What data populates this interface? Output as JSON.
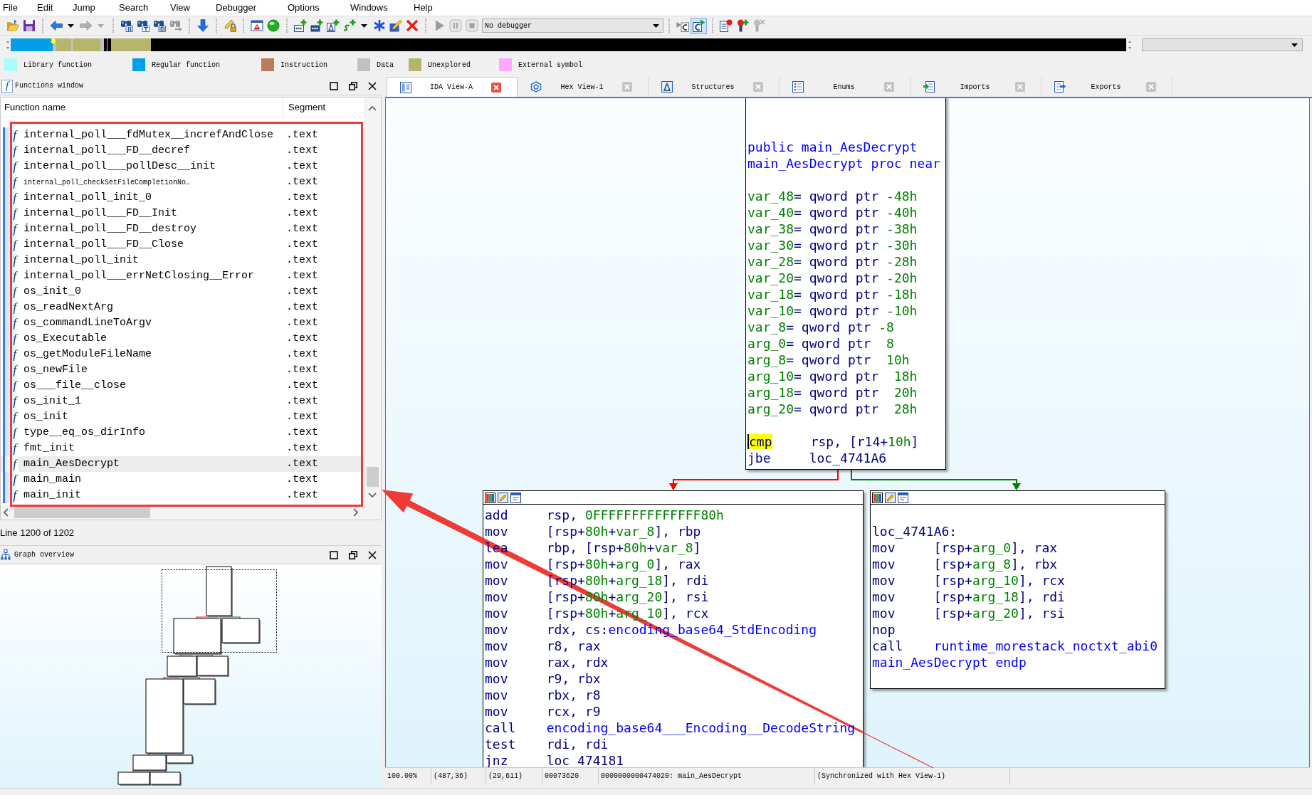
{
  "menu": [
    "File",
    "Edit",
    "Jump",
    "Search",
    "View",
    "Debugger",
    "Options",
    "Windows",
    "Help"
  ],
  "toolbar": [
    {
      "items": [
        {
          "kind": "button",
          "disabled": false,
          "pressed": false
        },
        {
          "kind": "button",
          "disabled": false,
          "pressed": false
        }
      ]
    },
    {
      "items": [
        {
          "kind": "button",
          "disabled": false,
          "pressed": false
        },
        {
          "kind": "caret",
          "disabled": false
        },
        {
          "kind": "button",
          "disabled": true,
          "pressed": false
        },
        {
          "kind": "caret",
          "disabled": true
        }
      ]
    },
    {
      "items": [
        {
          "kind": "button",
          "disabled": false,
          "pressed": false
        },
        {
          "kind": "button",
          "disabled": false,
          "pressed": false
        },
        {
          "kind": "button",
          "disabled": false,
          "pressed": false
        },
        {
          "kind": "button",
          "disabled": true,
          "pressed": false
        }
      ]
    },
    {
      "items": [
        {
          "kind": "button",
          "disabled": false,
          "pressed": false
        }
      ]
    },
    {
      "items": [
        {
          "kind": "button",
          "disabled": false,
          "pressed": false
        }
      ]
    },
    {
      "items": [
        {
          "kind": "button",
          "disabled": false,
          "pressed": false
        },
        {
          "kind": "button",
          "disabled": false,
          "pressed": false
        }
      ]
    },
    {
      "items": [
        {
          "kind": "button",
          "disabled": false,
          "pressed": false
        },
        {
          "kind": "button",
          "disabled": false,
          "pressed": false
        },
        {
          "kind": "button",
          "disabled": false,
          "pressed": false
        },
        {
          "kind": "button",
          "disabled": false,
          "pressed": false
        },
        {
          "kind": "caret",
          "disabled": false
        },
        {
          "kind": "button",
          "disabled": false,
          "pressed": false
        },
        {
          "kind": "button",
          "disabled": false,
          "pressed": false
        },
        {
          "kind": "button",
          "disabled": false,
          "pressed": false
        }
      ]
    },
    {
      "items": [
        {
          "kind": "button",
          "disabled": true,
          "pressed": false
        },
        {
          "kind": "button",
          "disabled": true,
          "pressed": false
        },
        {
          "kind": "button",
          "disabled": true,
          "pressed": false
        },
        {
          "kind": "select",
          "value": "No debugger"
        }
      ]
    },
    {
      "items": [
        {
          "kind": "button",
          "disabled": false,
          "pressed": false
        },
        {
          "kind": "button",
          "disabled": false,
          "pressed": true
        }
      ]
    },
    {
      "items": [
        {
          "kind": "button",
          "disabled": false,
          "pressed": false
        },
        {
          "kind": "button",
          "disabled": false,
          "pressed": false
        },
        {
          "kind": "button",
          "disabled": true,
          "pressed": false
        }
      ]
    }
  ],
  "legend": [
    {
      "label": "Library function",
      "color": "#a8fcfc"
    },
    {
      "label": "Regular function",
      "color": "#00a0e6"
    },
    {
      "label": "Instruction",
      "color": "#b87c5c"
    },
    {
      "label": "Data",
      "color": "#c0c0c0"
    },
    {
      "label": "Unexplored",
      "color": "#b4b46c"
    },
    {
      "label": "External symbol",
      "color": "#ffa8ff"
    }
  ],
  "functions_window": {
    "icon": "f",
    "title": "Functions window",
    "columns": [
      "Function name",
      "Segment"
    ],
    "rows": [
      {
        "icon": "f",
        "name": "internal_poll___fdMutex__increfAndClose",
        "segment": ".text",
        "selected": false,
        "squeezed": false
      },
      {
        "icon": "f",
        "name": "internal_poll___FD__decref",
        "segment": ".text",
        "selected": false,
        "squeezed": false
      },
      {
        "icon": "f",
        "name": "internal_poll___pollDesc__init",
        "segment": ".text",
        "selected": false,
        "squeezed": false
      },
      {
        "icon": "f",
        "name": "internal_poll_checkSetFileCompletionNo…",
        "segment": ".text",
        "selected": false,
        "squeezed": true
      },
      {
        "icon": "f",
        "name": "internal_poll_init_0",
        "segment": ".text",
        "selected": false,
        "squeezed": false
      },
      {
        "icon": "f",
        "name": "internal_poll___FD__Init",
        "segment": ".text",
        "selected": false,
        "squeezed": false
      },
      {
        "icon": "f",
        "name": "internal_poll___FD__destroy",
        "segment": ".text",
        "selected": false,
        "squeezed": false
      },
      {
        "icon": "f",
        "name": "internal_poll___FD__Close",
        "segment": ".text",
        "selected": false,
        "squeezed": false
      },
      {
        "icon": "f",
        "name": "internal_poll_init",
        "segment": ".text",
        "selected": false,
        "squeezed": false
      },
      {
        "icon": "f",
        "name": "internal_poll___errNetClosing__Error",
        "segment": ".text",
        "selected": false,
        "squeezed": false
      },
      {
        "icon": "f",
        "name": "os_init_0",
        "segment": ".text",
        "selected": false,
        "squeezed": false
      },
      {
        "icon": "f",
        "name": "os_readNextArg",
        "segment": ".text",
        "selected": false,
        "squeezed": false
      },
      {
        "icon": "f",
        "name": "os_commandLineToArgv",
        "segment": ".text",
        "selected": false,
        "squeezed": false
      },
      {
        "icon": "f",
        "name": "os_Executable",
        "segment": ".text",
        "selected": false,
        "squeezed": false
      },
      {
        "icon": "f",
        "name": "os_getModuleFileName",
        "segment": ".text",
        "selected": false,
        "squeezed": false
      },
      {
        "icon": "f",
        "name": "os_newFile",
        "segment": ".text",
        "selected": false,
        "squeezed": false
      },
      {
        "icon": "f",
        "name": "os___file__close",
        "segment": ".text",
        "selected": false,
        "squeezed": false
      },
      {
        "icon": "f",
        "name": "os_init_1",
        "segment": ".text",
        "selected": false,
        "squeezed": false
      },
      {
        "icon": "f",
        "name": "os_init",
        "segment": ".text",
        "selected": false,
        "squeezed": false
      },
      {
        "icon": "f",
        "name": "type__eq_os_dirInfo",
        "segment": ".text",
        "selected": false,
        "squeezed": false
      },
      {
        "icon": "f",
        "name": "fmt_init",
        "segment": ".text",
        "selected": false,
        "squeezed": false
      },
      {
        "icon": "f",
        "name": "main_AesDecrypt",
        "segment": ".text",
        "selected": true,
        "squeezed": false
      },
      {
        "icon": "f",
        "name": "main_main",
        "segment": ".text",
        "selected": false,
        "squeezed": false
      },
      {
        "icon": "f",
        "name": "main_init",
        "segment": ".text",
        "selected": false,
        "squeezed": false
      }
    ],
    "status": "Line 1200 of 1202"
  },
  "graph_overview": {
    "title": "Graph overview"
  },
  "tabs": [
    {
      "label": "IDA View-A",
      "selected": true
    },
    {
      "label": "Hex View-1",
      "selected": false
    },
    {
      "label": "Structures",
      "selected": false
    },
    {
      "label": "Enums",
      "selected": false
    },
    {
      "label": "Imports",
      "selected": false
    },
    {
      "label": "Exports",
      "selected": false
    }
  ],
  "graph": {
    "nodes": [
      {
        "blocks": [
          {
            "lines": [
              [
                {
                  "text": "public main_AesDecrypt",
                  "kind": "name"
                }
              ],
              [
                {
                  "text": "main_AesDecrypt proc near",
                  "kind": "name"
                }
              ]
            ]
          },
          {
            "lines": [
              [
                {
                  "text": "var_48",
                  "kind": "number"
                },
                {
                  "text": "= qword ptr ",
                  "kind": "plain"
                },
                {
                  "text": "-48h",
                  "kind": "number"
                }
              ],
              [
                {
                  "text": "var_40",
                  "kind": "number"
                },
                {
                  "text": "= qword ptr ",
                  "kind": "plain"
                },
                {
                  "text": "-40h",
                  "kind": "number"
                }
              ],
              [
                {
                  "text": "var_38",
                  "kind": "number"
                },
                {
                  "text": "= qword ptr ",
                  "kind": "plain"
                },
                {
                  "text": "-38h",
                  "kind": "number"
                }
              ],
              [
                {
                  "text": "var_30",
                  "kind": "number"
                },
                {
                  "text": "= qword ptr ",
                  "kind": "plain"
                },
                {
                  "text": "-30h",
                  "kind": "number"
                }
              ],
              [
                {
                  "text": "var_28",
                  "kind": "number"
                },
                {
                  "text": "= qword ptr ",
                  "kind": "plain"
                },
                {
                  "text": "-28h",
                  "kind": "number"
                }
              ],
              [
                {
                  "text": "var_20",
                  "kind": "number"
                },
                {
                  "text": "= qword ptr ",
                  "kind": "plain"
                },
                {
                  "text": "-20h",
                  "kind": "number"
                }
              ],
              [
                {
                  "text": "var_18",
                  "kind": "number"
                },
                {
                  "text": "= qword ptr ",
                  "kind": "plain"
                },
                {
                  "text": "-18h",
                  "kind": "number"
                }
              ],
              [
                {
                  "text": "var_10",
                  "kind": "number"
                },
                {
                  "text": "= qword ptr ",
                  "kind": "plain"
                },
                {
                  "text": "-10h",
                  "kind": "number"
                }
              ],
              [
                {
                  "text": "var_8",
                  "kind": "number"
                },
                {
                  "text": "= qword ptr ",
                  "kind": "plain"
                },
                {
                  "text": "-8",
                  "kind": "number"
                }
              ],
              [
                {
                  "text": "arg_0",
                  "kind": "number"
                },
                {
                  "text": "= qword ptr  ",
                  "kind": "plain"
                },
                {
                  "text": "8",
                  "kind": "number"
                }
              ],
              [
                {
                  "text": "arg_8",
                  "kind": "number"
                },
                {
                  "text": "= qword ptr  ",
                  "kind": "plain"
                },
                {
                  "text": "10h",
                  "kind": "number"
                }
              ],
              [
                {
                  "text": "arg_10",
                  "kind": "number"
                },
                {
                  "text": "= qword ptr  ",
                  "kind": "plain"
                },
                {
                  "text": "18h",
                  "kind": "number"
                }
              ],
              [
                {
                  "text": "arg_18",
                  "kind": "number"
                },
                {
                  "text": "= qword ptr  ",
                  "kind": "plain"
                },
                {
                  "text": "20h",
                  "kind": "number"
                }
              ],
              [
                {
                  "text": "arg_20",
                  "kind": "number"
                },
                {
                  "text": "= qword ptr  ",
                  "kind": "plain"
                },
                {
                  "text": "28h",
                  "kind": "number"
                }
              ]
            ]
          },
          {
            "lines": [
              [
                {
                  "text": "cmp",
                  "kind": "cursor"
                },
                {
                  "text": "     rsp, [r14+",
                  "kind": "plain"
                },
                {
                  "text": "10h",
                  "kind": "number"
                },
                {
                  "text": "]",
                  "kind": "plain"
                }
              ],
              [
                {
                  "text": "jbe     loc_4741A6",
                  "kind": "plain"
                }
              ]
            ]
          }
        ]
      },
      {
        "blocks": [
          {
            "lines": [
              [
                {
                  "text": "add     rsp, ",
                  "kind": "plain"
                },
                {
                  "text": "0FFFFFFFFFFFFFF80h",
                  "kind": "number"
                }
              ],
              [
                {
                  "text": "mov     [rsp+",
                  "kind": "plain"
                },
                {
                  "text": "80h",
                  "kind": "number"
                },
                {
                  "text": "+",
                  "kind": "plain"
                },
                {
                  "text": "var_8",
                  "kind": "number"
                },
                {
                  "text": "], rbp",
                  "kind": "plain"
                }
              ],
              [
                {
                  "text": "lea     rbp, [rsp+",
                  "kind": "plain"
                },
                {
                  "text": "80h",
                  "kind": "number"
                },
                {
                  "text": "+",
                  "kind": "plain"
                },
                {
                  "text": "var_8",
                  "kind": "number"
                },
                {
                  "text": "]",
                  "kind": "plain"
                }
              ],
              [
                {
                  "text": "mov     [rsp+",
                  "kind": "plain"
                },
                {
                  "text": "80h",
                  "kind": "number"
                },
                {
                  "text": "+",
                  "kind": "plain"
                },
                {
                  "text": "arg_0",
                  "kind": "number"
                },
                {
                  "text": "], rax",
                  "kind": "plain"
                }
              ],
              [
                {
                  "text": "mov     [rsp+",
                  "kind": "plain"
                },
                {
                  "text": "80h",
                  "kind": "number"
                },
                {
                  "text": "+",
                  "kind": "plain"
                },
                {
                  "text": "arg_18",
                  "kind": "number"
                },
                {
                  "text": "], rdi",
                  "kind": "plain"
                }
              ],
              [
                {
                  "text": "mov     [rsp+",
                  "kind": "plain"
                },
                {
                  "text": "80h",
                  "kind": "number"
                },
                {
                  "text": "+",
                  "kind": "plain"
                },
                {
                  "text": "arg_20",
                  "kind": "number"
                },
                {
                  "text": "], rsi",
                  "kind": "plain"
                }
              ],
              [
                {
                  "text": "mov     [rsp+",
                  "kind": "plain"
                },
                {
                  "text": "80h",
                  "kind": "number"
                },
                {
                  "text": "+",
                  "kind": "plain"
                },
                {
                  "text": "arg_10",
                  "kind": "number"
                },
                {
                  "text": "], rcx",
                  "kind": "plain"
                }
              ],
              [
                {
                  "text": "mov     rdx, cs:",
                  "kind": "plain"
                },
                {
                  "text": "encoding_base64_StdEncoding",
                  "kind": "name"
                }
              ],
              [
                {
                  "text": "mov     r8, rax",
                  "kind": "plain"
                }
              ],
              [
                {
                  "text": "mov     rax, rdx",
                  "kind": "plain"
                }
              ],
              [
                {
                  "text": "mov     r9, rbx",
                  "kind": "plain"
                }
              ],
              [
                {
                  "text": "mov     rbx, r8",
                  "kind": "plain"
                }
              ],
              [
                {
                  "text": "mov     rcx, r9",
                  "kind": "plain"
                }
              ],
              [
                {
                  "text": "call    ",
                  "kind": "plain"
                },
                {
                  "text": "encoding_base64___Encoding__DecodeString",
                  "kind": "name"
                }
              ],
              [
                {
                  "text": "test    rdi, rdi",
                  "kind": "plain"
                }
              ],
              [
                {
                  "text": "jnz     loc_474181",
                  "kind": "plain"
                }
              ]
            ]
          }
        ]
      },
      {
        "blocks": [
          {
            "lines": [
              [
                {
                  "text": "loc_4741A6:",
                  "kind": "plain"
                }
              ],
              [
                {
                  "text": "mov     [rsp+",
                  "kind": "plain"
                },
                {
                  "text": "arg_0",
                  "kind": "number"
                },
                {
                  "text": "], rax",
                  "kind": "plain"
                }
              ],
              [
                {
                  "text": "mov     [rsp+",
                  "kind": "plain"
                },
                {
                  "text": "arg_8",
                  "kind": "number"
                },
                {
                  "text": "], rbx",
                  "kind": "plain"
                }
              ],
              [
                {
                  "text": "mov     [rsp+",
                  "kind": "plain"
                },
                {
                  "text": "arg_10",
                  "kind": "number"
                },
                {
                  "text": "], rcx",
                  "kind": "plain"
                }
              ],
              [
                {
                  "text": "mov     [rsp+",
                  "kind": "plain"
                },
                {
                  "text": "arg_18",
                  "kind": "number"
                },
                {
                  "text": "], rdi",
                  "kind": "plain"
                }
              ],
              [
                {
                  "text": "mov     [rsp+",
                  "kind": "plain"
                },
                {
                  "text": "arg_20",
                  "kind": "number"
                },
                {
                  "text": "], rsi",
                  "kind": "plain"
                }
              ],
              [
                {
                  "text": "nop",
                  "kind": "plain"
                }
              ],
              [
                {
                  "text": "call    ",
                  "kind": "plain"
                },
                {
                  "text": "runtime_morestack_noctxt_abi0",
                  "kind": "name"
                }
              ],
              [
                {
                  "text": "main_AesDecrypt endp",
                  "kind": "name"
                }
              ]
            ]
          }
        ]
      }
    ],
    "edges": [
      {
        "color": "#ff0000"
      },
      {
        "color": "#008000"
      }
    ]
  },
  "status_bar": [
    "100.00%",
    "(487,36)",
    "(29,611)",
    "00073620",
    "0000000000474020: main_AesDecrypt",
    "(Synchronized with Hex View-1)"
  ]
}
